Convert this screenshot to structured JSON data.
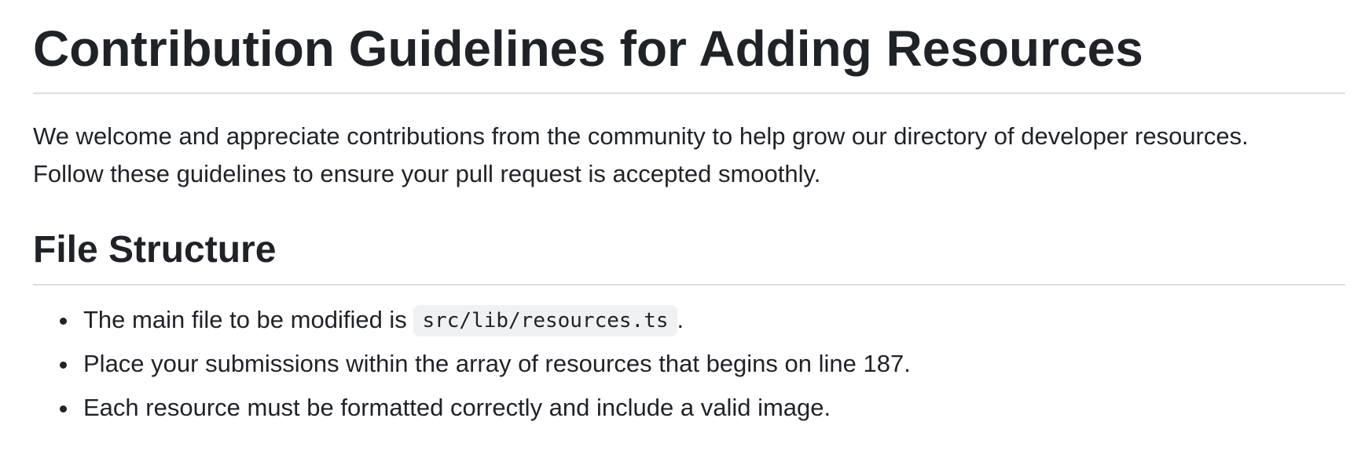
{
  "document": {
    "title": "Contribution Guidelines for Adding Resources",
    "intro": {
      "line1": "We welcome and appreciate contributions from the community to help grow our directory of developer resources.",
      "line2": "Follow these guidelines to ensure your pull request is accepted smoothly."
    },
    "sections": [
      {
        "heading": "File Structure",
        "items": [
          {
            "before": "The main file to be modified is ",
            "code": "src/lib/resources.ts",
            "after": "."
          },
          {
            "text": "Place your submissions within the array of resources that begins on line 187."
          },
          {
            "text": "Each resource must be formatted correctly and include a valid image."
          }
        ]
      }
    ]
  }
}
